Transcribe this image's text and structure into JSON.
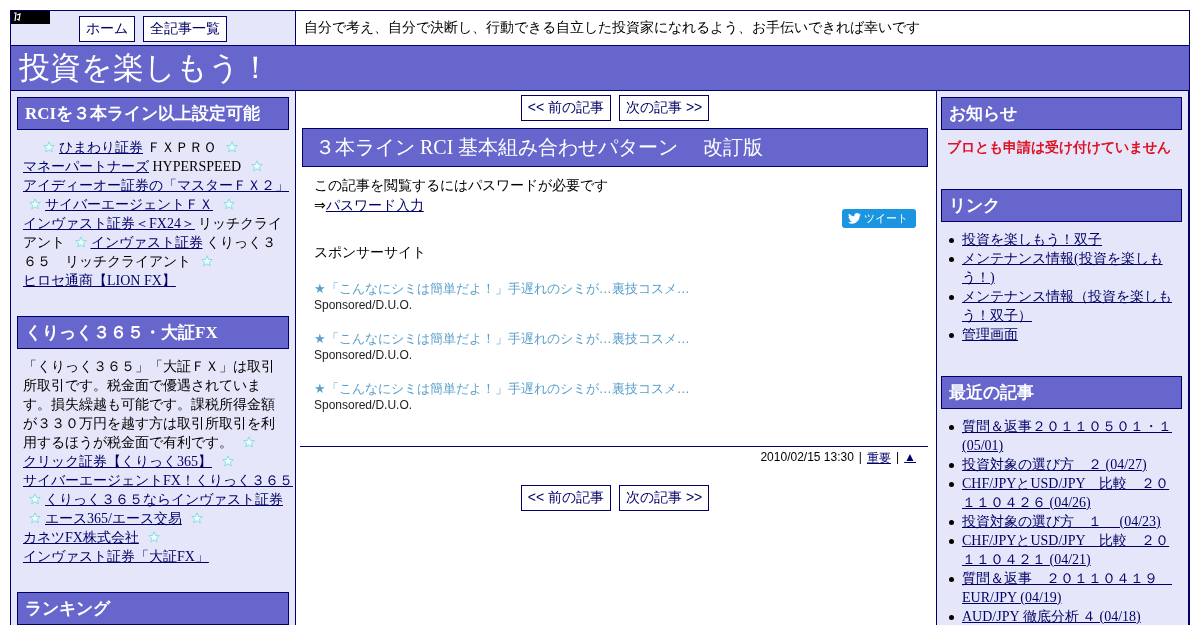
{
  "header": {
    "nav": [
      "ホーム",
      "全記事一覧"
    ],
    "tagline": "自分で考え、自分で決断し、行動できる自立した投資家になれるよう、お手伝いできれば幸いです"
  },
  "site_title": "投資を楽しもう！",
  "left_sidebar": [
    {
      "title": "RCIを３本ライン以上設定可能",
      "parts": [
        {
          "kind": "link",
          "text": "ひまわり証券"
        },
        {
          "kind": "text",
          "text": "ＦＸＰＲＯ"
        },
        {
          "kind": "link",
          "text": "マネーパートナーズ"
        },
        {
          "kind": "text",
          "text": "HYPERSPEED"
        },
        {
          "kind": "link",
          "text": "アイディーオー証券の「マスターＦＸ２」"
        },
        {
          "kind": "link",
          "text": "サイバーエージェントＦＸ"
        },
        {
          "kind": "link",
          "text": "インヴァスト証券＜FX24＞"
        },
        {
          "kind": "text",
          "text": "リッチクライアント"
        },
        {
          "kind": "link",
          "text": "インヴァスト証券"
        },
        {
          "kind": "text",
          "text": "くりっく３６５　リッチクライアント"
        },
        {
          "kind": "link",
          "text": "ヒロセ通商【LION FX】"
        }
      ]
    },
    {
      "title": "くりっく３６５・大証FX",
      "parts": [
        {
          "kind": "text",
          "text": "「くりっく３６５」「大証ＦＸ」は取引所取引です。税金面で優遇されています。損失繰越も可能です。課税所得金額が３３０万円を越す方は取引所取引を利用するほうが税金面で有利です。"
        },
        {
          "kind": "link",
          "text": "クリック証券【くりっく365】"
        },
        {
          "kind": "link",
          "text": "サイバーエージェントFX！くりっく３６５"
        },
        {
          "kind": "link",
          "text": "くりっく３６５ならインヴァスト証券"
        },
        {
          "kind": "link",
          "text": "エース365/エース交易"
        },
        {
          "kind": "link",
          "text": "カネツFX株式会社"
        },
        {
          "kind": "link",
          "text": "インヴァスト証券「大証FX」"
        }
      ]
    },
    {
      "title": "ランキング"
    }
  ],
  "article": {
    "nav_top": [
      "<< 前の記事",
      "次の記事 >>"
    ],
    "title": "３本ライン RCI 基本組み合わせパターン　 改訂版",
    "notice": "この記事を閲覧するにはパスワードが必要です",
    "link_prefix": "⇒",
    "link": "パスワード入力",
    "tweet": "ツイート",
    "sponsor_heading": "スポンサーサイト",
    "ads": [
      {
        "title": "★「こんなにシミは簡単だよ！」手遅れのシミが…裏技コスメ…",
        "source": "Sponsored/D.U.O."
      },
      {
        "title": "★「こんなにシミは簡単だよ！」手遅れのシミが…裏技コスメ…",
        "source": "Sponsored/D.U.O."
      },
      {
        "title": "★「こんなにシミは簡単だよ！」手遅れのシミが…裏技コスメ…",
        "source": "Sponsored/D.U.O."
      }
    ],
    "meta": [
      {
        "kind": "text",
        "text": "2010/02/15 13:30"
      },
      {
        "kind": "text",
        "text": "|"
      },
      {
        "kind": "link",
        "text": "重要"
      },
      {
        "kind": "text",
        "text": "|"
      },
      {
        "kind": "link",
        "text": "▲"
      }
    ],
    "nav_bottom": [
      "<< 前の記事",
      "次の記事 >>"
    ]
  },
  "right_sidebar": [
    {
      "title": "お知らせ",
      "kind": "notice",
      "text": "ブロとも申請は受け付けていません"
    },
    {
      "title": "リンク",
      "kind": "list",
      "items": [
        "投資を楽しもう！双子",
        "メンテナンス情報(投資を楽しもう！)",
        "メンテナンス情報（投資を楽しもう！双子）",
        "管理画面"
      ]
    },
    {
      "title": "最近の記事",
      "kind": "list",
      "items": [
        "質問＆返事２０１１０５０１・１ (05/01)",
        "投資対象の選び方　２ (04/27)",
        "CHF/JPYとUSD/JPY　比較　２０１１０４２６ (04/26)",
        "投資対象の選び方　１　 (04/23)",
        "CHF/JPYとUSD/JPY　比較　２０１１０４２１ (04/21)",
        "質問＆返事　２０１１０４１９　EUR/JPY (04/19)",
        "AUD/JPY 徹底分析 ４ (04/18)"
      ]
    }
  ]
}
